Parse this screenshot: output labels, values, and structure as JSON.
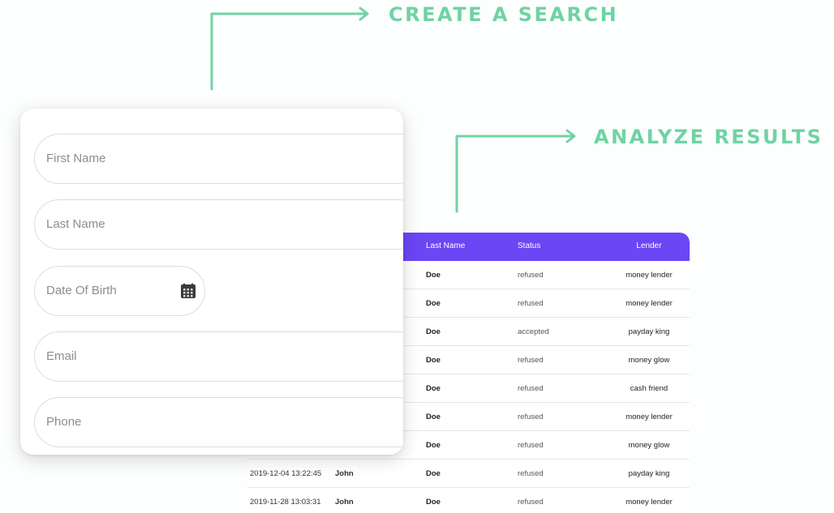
{
  "callouts": {
    "create": "CREATE A SEARCH",
    "analyze": "ANALYZE RESULTS"
  },
  "colors": {
    "accent_green": "#6fd3a4",
    "table_header": "#6a46f5"
  },
  "form": {
    "fields": [
      {
        "placeholder": "First Name"
      },
      {
        "placeholder": "Last Name"
      },
      {
        "placeholder": "Date Of Birth",
        "icon": "calendar-icon"
      },
      {
        "placeholder": "Email"
      },
      {
        "placeholder": "Phone"
      }
    ]
  },
  "results": {
    "columns": {
      "last_name": "Last Name",
      "status": "Status",
      "lender": "Lender"
    },
    "rows": [
      {
        "date": "",
        "first": "",
        "last": "Doe",
        "status": "refused",
        "lender": "money lender"
      },
      {
        "date": "",
        "first": "",
        "last": "Doe",
        "status": "refused",
        "lender": "money lender"
      },
      {
        "date": "",
        "first": "",
        "last": "Doe",
        "status": "accepted",
        "lender": "payday king"
      },
      {
        "date": "",
        "first": "",
        "last": "Doe",
        "status": "refused",
        "lender": "money glow"
      },
      {
        "date": "",
        "first": "",
        "last": "Doe",
        "status": "refused",
        "lender": "cash friend"
      },
      {
        "date": "",
        "first": "",
        "last": "Doe",
        "status": "refused",
        "lender": "money lender"
      },
      {
        "date": "",
        "first": "",
        "last": "Doe",
        "status": "refused",
        "lender": "money glow"
      },
      {
        "date": "2019-12-04 13:22:45",
        "first": "John",
        "last": "Doe",
        "status": "refused",
        "lender": "payday king"
      },
      {
        "date": "2019-11-28 13:03:31",
        "first": "John",
        "last": "Doe",
        "status": "refused",
        "lender": "money lender"
      }
    ]
  }
}
